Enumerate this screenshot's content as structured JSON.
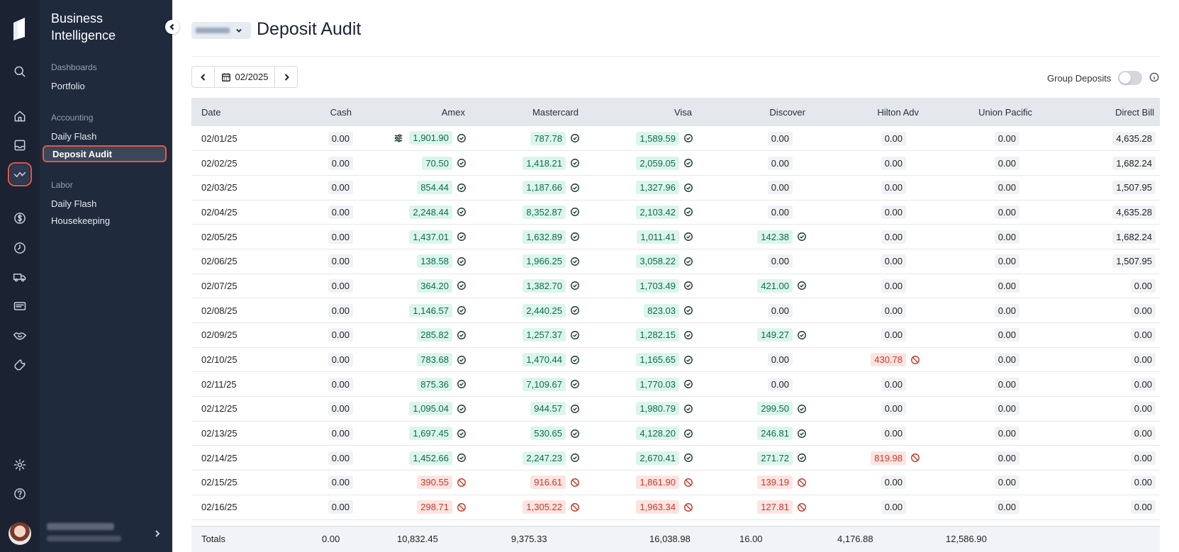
{
  "app": {
    "brand_line1": "Business",
    "brand_line2": "Intelligence"
  },
  "rail_icons": [
    "logo-icon",
    "search-icon",
    "home-icon",
    "inbox-icon",
    "activity-icon",
    "dollar-icon",
    "clock-icon",
    "truck-icon",
    "card-icon",
    "handshake-icon",
    "wrench-icon",
    "gear-icon",
    "help-icon"
  ],
  "sidebar": {
    "sections": [
      {
        "label": "Dashboards",
        "items": [
          "Portfolio"
        ]
      },
      {
        "label": "Accounting",
        "items": [
          "Daily Flash",
          "Deposit Audit"
        ]
      },
      {
        "label": "Labor",
        "items": [
          "Daily Flash",
          "Housekeeping"
        ]
      }
    ],
    "active_item": "Deposit Audit"
  },
  "header": {
    "title": "Deposit Audit"
  },
  "toolbar": {
    "month": "02/2025",
    "group_deposits_label": "Group Deposits",
    "group_deposits_on": false
  },
  "colors": {
    "ok_bg": "#dcf5ec",
    "bad_bg": "#fde4e1",
    "bad_text": "#c53a2c",
    "accent": "#e25a45"
  },
  "table": {
    "columns": [
      "Date",
      "Cash",
      "Amex",
      "Mastercard",
      "Visa",
      "Discover",
      "Hilton Adv",
      "Union Pacific",
      "Direct Bill"
    ],
    "rows": [
      {
        "date": "02/01/25",
        "cells": [
          [
            "0.00",
            ""
          ],
          [
            "1,901.90",
            "ok"
          ],
          [
            "787.78",
            "ok"
          ],
          [
            "1,589.59",
            "ok"
          ],
          [
            "0.00",
            ""
          ],
          [
            "0.00",
            ""
          ],
          [
            "0.00",
            ""
          ],
          [
            "4,635.28",
            ""
          ]
        ]
      },
      {
        "date": "02/02/25",
        "cells": [
          [
            "0.00",
            ""
          ],
          [
            "70.50",
            "ok"
          ],
          [
            "1,418.21",
            "ok"
          ],
          [
            "2,059.05",
            "ok"
          ],
          [
            "0.00",
            ""
          ],
          [
            "0.00",
            ""
          ],
          [
            "0.00",
            ""
          ],
          [
            "1,682.24",
            ""
          ]
        ]
      },
      {
        "date": "02/03/25",
        "cells": [
          [
            "0.00",
            ""
          ],
          [
            "854.44",
            "ok"
          ],
          [
            "1,187.66",
            "ok"
          ],
          [
            "1,327.96",
            "ok"
          ],
          [
            "0.00",
            ""
          ],
          [
            "0.00",
            ""
          ],
          [
            "0.00",
            ""
          ],
          [
            "1,507.95",
            ""
          ]
        ]
      },
      {
        "date": "02/04/25",
        "cells": [
          [
            "0.00",
            ""
          ],
          [
            "2,248.44",
            "ok"
          ],
          [
            "8,352.87",
            "ok"
          ],
          [
            "2,103.42",
            "ok"
          ],
          [
            "0.00",
            ""
          ],
          [
            "0.00",
            ""
          ],
          [
            "0.00",
            ""
          ],
          [
            "4,635.28",
            ""
          ]
        ]
      },
      {
        "date": "02/05/25",
        "cells": [
          [
            "0.00",
            ""
          ],
          [
            "1,437.01",
            "ok"
          ],
          [
            "1,632.89",
            "ok"
          ],
          [
            "1,011.41",
            "ok"
          ],
          [
            "142.38",
            "ok"
          ],
          [
            "0.00",
            ""
          ],
          [
            "0.00",
            ""
          ],
          [
            "1,682.24",
            ""
          ]
        ]
      },
      {
        "date": "02/06/25",
        "cells": [
          [
            "0.00",
            ""
          ],
          [
            "138.58",
            "ok"
          ],
          [
            "1,966.25",
            "ok"
          ],
          [
            "3,058.22",
            "ok"
          ],
          [
            "0.00",
            ""
          ],
          [
            "0.00",
            ""
          ],
          [
            "0.00",
            ""
          ],
          [
            "1,507.95",
            ""
          ]
        ]
      },
      {
        "date": "02/07/25",
        "cells": [
          [
            "0.00",
            ""
          ],
          [
            "364.20",
            "ok"
          ],
          [
            "1,382.70",
            "ok"
          ],
          [
            "1,703.49",
            "ok"
          ],
          [
            "421.00",
            "ok"
          ],
          [
            "0.00",
            ""
          ],
          [
            "0.00",
            ""
          ],
          [
            "0.00",
            ""
          ]
        ]
      },
      {
        "date": "02/08/25",
        "cells": [
          [
            "0.00",
            ""
          ],
          [
            "1,146.57",
            "ok"
          ],
          [
            "2,440.25",
            "ok"
          ],
          [
            "823.03",
            "ok"
          ],
          [
            "0.00",
            ""
          ],
          [
            "0.00",
            ""
          ],
          [
            "0.00",
            ""
          ],
          [
            "0.00",
            ""
          ]
        ]
      },
      {
        "date": "02/09/25",
        "cells": [
          [
            "0.00",
            ""
          ],
          [
            "285.82",
            "ok"
          ],
          [
            "1,257.37",
            "ok"
          ],
          [
            "1,282.15",
            "ok"
          ],
          [
            "149.27",
            "ok"
          ],
          [
            "0.00",
            ""
          ],
          [
            "0.00",
            ""
          ],
          [
            "0.00",
            ""
          ]
        ]
      },
      {
        "date": "02/10/25",
        "cells": [
          [
            "0.00",
            ""
          ],
          [
            "783.68",
            "ok"
          ],
          [
            "1,470.44",
            "ok"
          ],
          [
            "1,165.65",
            "ok"
          ],
          [
            "0.00",
            ""
          ],
          [
            "430.78",
            "bad"
          ],
          [
            "0.00",
            ""
          ],
          [
            "0.00",
            ""
          ]
        ]
      },
      {
        "date": "02/11/25",
        "cells": [
          [
            "0.00",
            ""
          ],
          [
            "875.36",
            "ok"
          ],
          [
            "7,109.67",
            "ok"
          ],
          [
            "1,770.03",
            "ok"
          ],
          [
            "0.00",
            ""
          ],
          [
            "0.00",
            ""
          ],
          [
            "0.00",
            ""
          ],
          [
            "0.00",
            ""
          ]
        ]
      },
      {
        "date": "02/12/25",
        "cells": [
          [
            "0.00",
            ""
          ],
          [
            "1,095.04",
            "ok"
          ],
          [
            "944.57",
            "ok"
          ],
          [
            "1,980.79",
            "ok"
          ],
          [
            "299.50",
            "ok"
          ],
          [
            "0.00",
            ""
          ],
          [
            "0.00",
            ""
          ],
          [
            "0.00",
            ""
          ]
        ]
      },
      {
        "date": "02/13/25",
        "cells": [
          [
            "0.00",
            ""
          ],
          [
            "1,697.45",
            "ok"
          ],
          [
            "530.65",
            "ok"
          ],
          [
            "4,128.20",
            "ok"
          ],
          [
            "246.81",
            "ok"
          ],
          [
            "0.00",
            ""
          ],
          [
            "0.00",
            ""
          ],
          [
            "0.00",
            ""
          ]
        ]
      },
      {
        "date": "02/14/25",
        "cells": [
          [
            "0.00",
            ""
          ],
          [
            "1,452.66",
            "ok"
          ],
          [
            "2,247.23",
            "ok"
          ],
          [
            "2,670.41",
            "ok"
          ],
          [
            "271.72",
            "ok"
          ],
          [
            "819.98",
            "bad"
          ],
          [
            "0.00",
            ""
          ],
          [
            "0.00",
            ""
          ]
        ]
      },
      {
        "date": "02/15/25",
        "cells": [
          [
            "0.00",
            ""
          ],
          [
            "390.55",
            "bad"
          ],
          [
            "916.61",
            "bad"
          ],
          [
            "1,861.90",
            "bad"
          ],
          [
            "139.19",
            "bad"
          ],
          [
            "0.00",
            ""
          ],
          [
            "0.00",
            ""
          ],
          [
            "0.00",
            ""
          ]
        ]
      },
      {
        "date": "02/16/25",
        "cells": [
          [
            "0.00",
            ""
          ],
          [
            "298.71",
            "bad"
          ],
          [
            "1,305.22",
            "bad"
          ],
          [
            "1,963.34",
            "bad"
          ],
          [
            "127.81",
            "bad"
          ],
          [
            "0.00",
            ""
          ],
          [
            "0.00",
            ""
          ],
          [
            "0.00",
            ""
          ]
        ]
      }
    ],
    "adjusted_cell": {
      "row": 0,
      "col": 1
    },
    "totals": {
      "label": "Totals",
      "values": [
        "0.00",
        "10,832.45",
        "9,375.33",
        "16,038.98",
        "16.00",
        "4,176.88",
        "12,586.90",
        ""
      ]
    }
  }
}
